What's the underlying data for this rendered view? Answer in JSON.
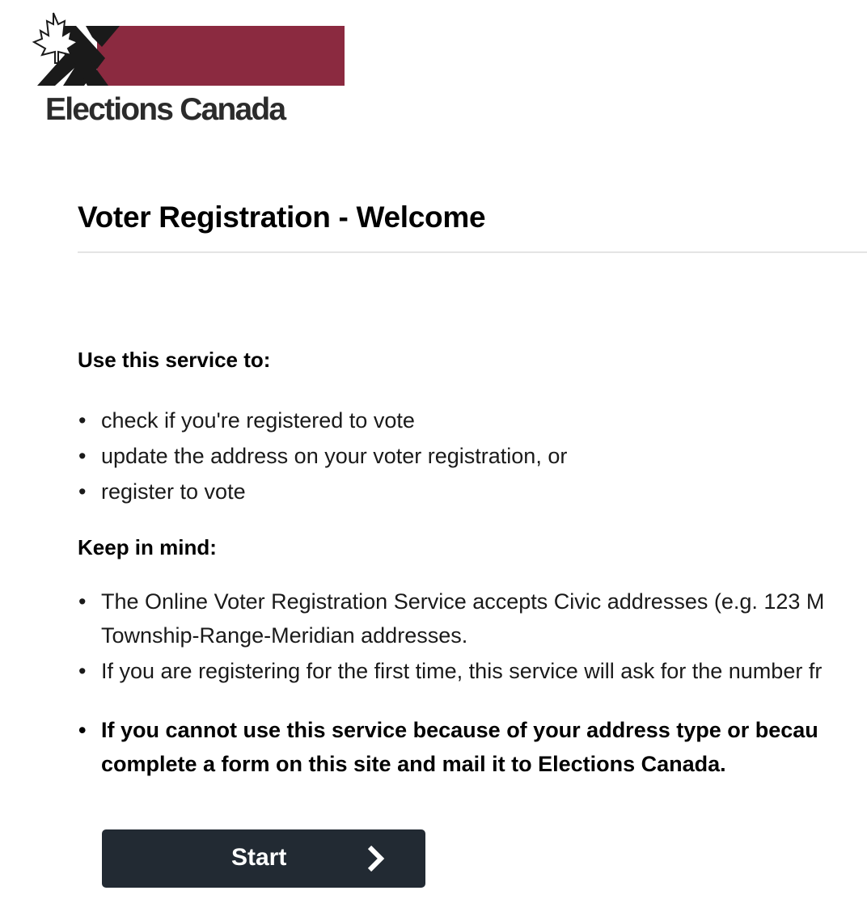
{
  "logo": {
    "text": "Elections Canada",
    "icon": "maple-leaf-x-logo",
    "colors": {
      "bar": "#8b2a40",
      "x": "#1a1a1a",
      "leaf": "#ffffff"
    }
  },
  "page_title": "Voter Registration - Welcome",
  "use_section": {
    "heading": "Use this service to:",
    "items": [
      "check if you're registered to vote",
      "update the address on your voter registration, or",
      "register to vote"
    ]
  },
  "keep_section": {
    "heading": "Keep in mind:",
    "items": [
      "The Online Voter Registration Service accepts Civic addresses (e.g. 123 M Township-Range-Meridian addresses.",
      "If you are registering for the first time, this service will ask for the number fr"
    ],
    "bold_item": "If you cannot use this service because of your address type or becau complete a form on this site and mail it to Elections Canada."
  },
  "start_button": {
    "label": "Start",
    "icon": "chevron-right-icon",
    "color": "#222a33"
  },
  "bullet_char": "•"
}
